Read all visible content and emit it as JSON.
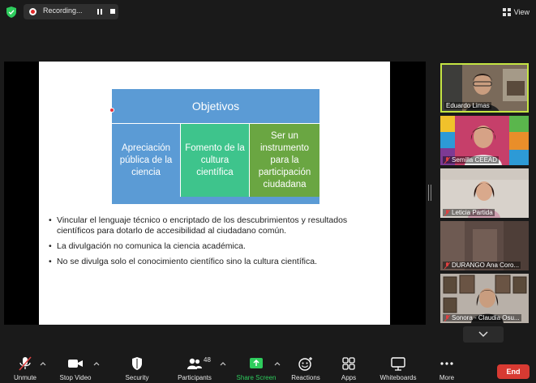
{
  "top": {
    "recording_label": "Recording...",
    "view_label": "View"
  },
  "slide": {
    "header": "Objetivos",
    "boxes": [
      "Apreciación pública de la ciencia",
      "Fomento de la cultura científica",
      "Ser un instrumento para la participación ciudadana"
    ],
    "bullets": [
      "Vincular el lenguaje técnico o encriptado de los descubrimientos y resultados científicos para dotarlo de accesibilidad al ciudadano común.",
      "La divulgación no comunica la ciencia académica.",
      "No se divulga solo el conocimiento científico sino la cultura científica."
    ]
  },
  "participants": [
    {
      "name": "Eduardo Limas",
      "active": true
    },
    {
      "name": "Semilla CEEAD",
      "muted": true
    },
    {
      "name": "Leticia Partida",
      "muted": true
    },
    {
      "name": "DURANGO Ana Coro...",
      "muted": true
    },
    {
      "name": "Sonora - Claudia Osu...",
      "muted": true
    }
  ],
  "toolbar": {
    "unmute": "Unmute",
    "stop_video": "Stop Video",
    "security": "Security",
    "participants": "Participants",
    "participants_count": "48",
    "share_screen": "Share Screen",
    "reactions": "Reactions",
    "apps": "Apps",
    "whiteboards": "Whiteboards",
    "more": "More",
    "end": "End"
  },
  "colors": {
    "accent_green": "#2ecc5d",
    "slide_blue": "#5b9bd5",
    "slide_teal": "#3ec48c",
    "slide_green": "#6aa642",
    "end_red": "#d83a32",
    "active_border": "#c5e543"
  }
}
